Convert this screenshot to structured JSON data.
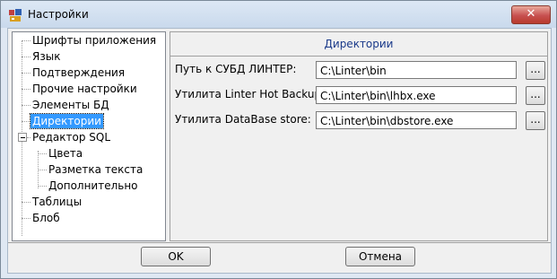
{
  "window": {
    "title": "Настройки",
    "close_label": "✕"
  },
  "tree": {
    "items": [
      {
        "label": "Шрифты приложения",
        "depth": 0
      },
      {
        "label": "Язык",
        "depth": 0
      },
      {
        "label": "Подтверждения",
        "depth": 0
      },
      {
        "label": "Прочие настройки",
        "depth": 0
      },
      {
        "label": "Элементы БД",
        "depth": 0
      },
      {
        "label": "Директории",
        "depth": 0,
        "selected": true
      },
      {
        "label": "Редактор SQL",
        "depth": 0,
        "expanded": true
      },
      {
        "label": "Цвета",
        "depth": 1
      },
      {
        "label": "Разметка текста",
        "depth": 1
      },
      {
        "label": "Дополнительно",
        "depth": 1
      },
      {
        "label": "Таблицы",
        "depth": 0
      },
      {
        "label": "Блоб",
        "depth": 0
      }
    ]
  },
  "panel": {
    "header": "Директории",
    "rows": [
      {
        "label": "Путь к СУБД ЛИНТЕР:",
        "value": "C:\\Linter\\bin",
        "browse": "..."
      },
      {
        "label": "Утилита Linter Hot Backup:",
        "value": "C:\\Linter\\bin\\lhbx.exe",
        "browse": "..."
      },
      {
        "label": "Утилита DataBase store:",
        "value": "C:\\Linter\\bin\\dbstore.exe",
        "browse": "..."
      }
    ]
  },
  "buttons": {
    "ok": "OK",
    "cancel": "Отмена"
  },
  "colors": {
    "selection": "#3399ff",
    "header_text": "#1a3a8a"
  }
}
